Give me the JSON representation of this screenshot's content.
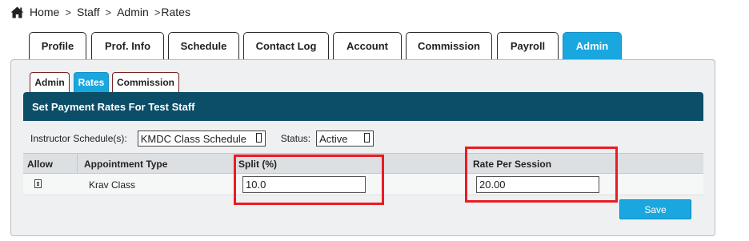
{
  "breadcrumb": {
    "icon": "home-icon",
    "items": [
      "Home",
      "Staff",
      "Admin",
      "Rates"
    ],
    "separator": ">"
  },
  "top_tabs": [
    {
      "label": "Profile",
      "active": false
    },
    {
      "label": "Prof. Info",
      "active": false
    },
    {
      "label": "Schedule",
      "active": false
    },
    {
      "label": "Contact Log",
      "active": false
    },
    {
      "label": "Account",
      "active": false
    },
    {
      "label": "Commission",
      "active": false
    },
    {
      "label": "Payroll",
      "active": false
    },
    {
      "label": "Admin",
      "active": true
    }
  ],
  "sub_tabs": [
    {
      "label": "Admin",
      "active": false
    },
    {
      "label": "Rates",
      "active": true
    },
    {
      "label": "Commission",
      "active": false
    }
  ],
  "banner": {
    "title": "Set Payment Rates For Test Staff"
  },
  "filters": {
    "schedule_label": "Instructor Schedule(s):",
    "schedule_value": "KMDC Class Schedule",
    "status_label": "Status:",
    "status_value": "Active"
  },
  "table": {
    "headers": {
      "allow": "Allow",
      "type": "Appointment Type",
      "split": "Split (%)",
      "rate": "Rate Per Session"
    },
    "rows": [
      {
        "allow": false,
        "type": "Krav Class",
        "split": "10.0",
        "rate": "20.00"
      }
    ]
  },
  "actions": {
    "save_label": "Save"
  },
  "colors": {
    "accent": "#1aa7e0",
    "banner": "#0c4d67",
    "highlight": "#ea1c24",
    "panel": "#eef0f1"
  }
}
